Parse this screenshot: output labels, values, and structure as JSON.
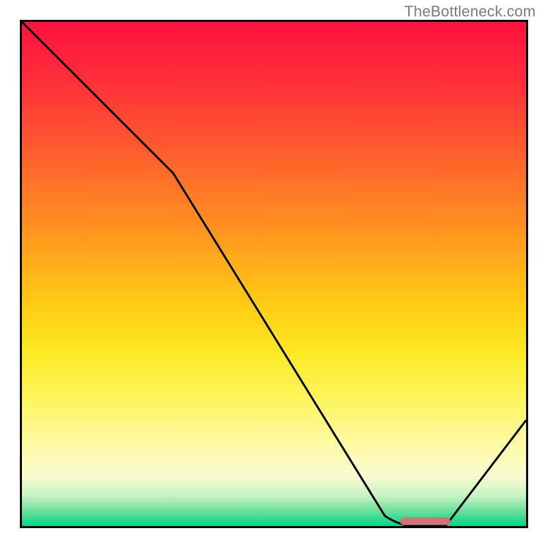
{
  "watermark": "TheBottleneck.com",
  "chart_data": {
    "type": "line",
    "title": "",
    "xlabel": "",
    "ylabel": "",
    "xlim": [
      0,
      100
    ],
    "ylim": [
      0,
      100
    ],
    "grid": false,
    "legend": false,
    "series": [
      {
        "name": "bottleneck-curve",
        "x": [
          0,
          22,
          72,
          78,
          84,
          100
        ],
        "y": [
          100,
          78,
          2,
          0,
          0,
          21
        ]
      }
    ],
    "marker": {
      "name": "optimal-range",
      "x_start": 75,
      "x_end": 85,
      "y": 0.6,
      "color": "#cf7373"
    },
    "gradient_stops": [
      {
        "pos": 0,
        "color": "#ff113f"
      },
      {
        "pos": 25,
        "color": "#ff5a2f"
      },
      {
        "pos": 55,
        "color": "#ffc814"
      },
      {
        "pos": 75,
        "color": "#fdf55e"
      },
      {
        "pos": 94,
        "color": "#c8f3c4"
      },
      {
        "pos": 100,
        "color": "#00d68b"
      }
    ]
  }
}
